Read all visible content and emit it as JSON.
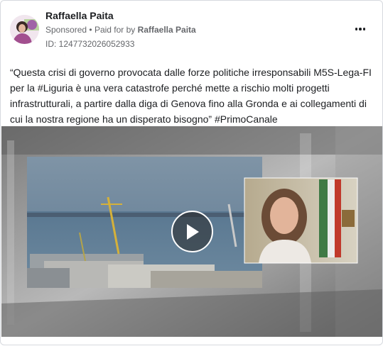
{
  "post": {
    "page_name": "Raffaella Paita",
    "sponsored_label": "Sponsored",
    "separator": "•",
    "paid_for_prefix": "Paid for by",
    "paid_for_by": "Raffaella Paita",
    "ad_id": "ID: 1247732026052933",
    "text": "“Questa crisi di governo provocata dalle forze politiche irresponsabili M5S-Lega-FI per la #Liguria è una vera catastrofe perché mette a rischio molti progetti infrastrutturali, a partire dalla diga di Genova fino alla Gronda e ai collegamenti di cui la nostra regione ha un disperato bisogno” #PrimoCanale"
  },
  "icons": {
    "more": "more-options-icon",
    "play": "play-icon"
  },
  "colors": {
    "primary_text": "#1c1e21",
    "secondary_text": "#65676b",
    "border": "#d6d9de",
    "avatar_brand": "#9b4fa8"
  }
}
